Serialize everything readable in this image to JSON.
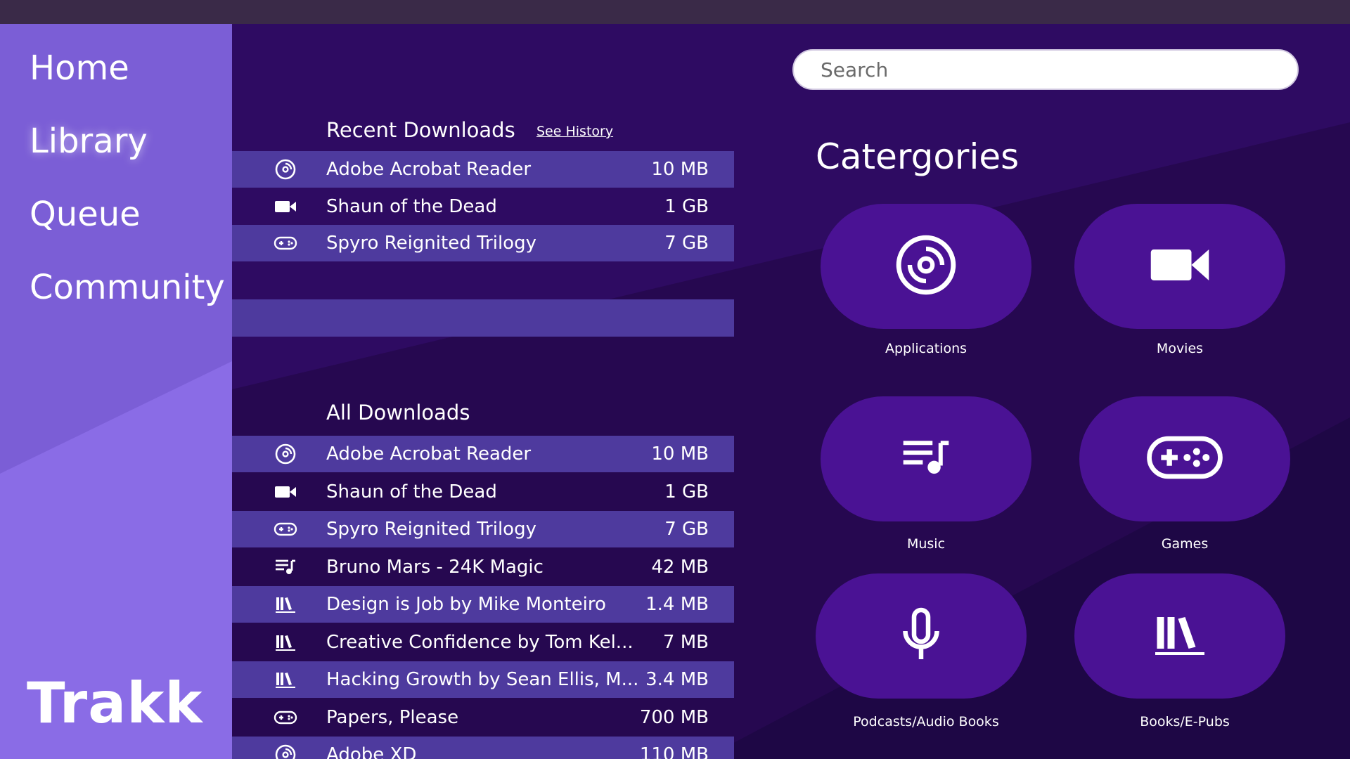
{
  "sidebar": {
    "items": [
      {
        "label": "Home",
        "active": false
      },
      {
        "label": "Library",
        "active": true
      },
      {
        "label": "Queue",
        "active": false
      },
      {
        "label": "Community",
        "active": false
      }
    ],
    "brand": "Trakk"
  },
  "recent": {
    "heading": "Recent Downloads",
    "see_history": "See History",
    "rows": [
      {
        "icon": "disc-icon",
        "name": "Adobe Acrobat Reader",
        "size": "10 MB"
      },
      {
        "icon": "video-camera-icon",
        "name": "Shaun of the Dead",
        "size": "1 GB"
      },
      {
        "icon": "gamepad-icon",
        "name": "Spyro Reignited Trilogy",
        "size": "7 GB"
      }
    ]
  },
  "all": {
    "heading": "All Downloads",
    "rows": [
      {
        "icon": "disc-icon",
        "name": "Adobe Acrobat Reader",
        "size": "10 MB"
      },
      {
        "icon": "video-camera-icon",
        "name": "Shaun of the Dead",
        "size": "1 GB"
      },
      {
        "icon": "gamepad-icon",
        "name": "Spyro Reignited Trilogy",
        "size": "7 GB"
      },
      {
        "icon": "music-list-icon",
        "name": "Bruno Mars - 24K Magic",
        "size": "42 MB"
      },
      {
        "icon": "books-icon",
        "name": "Design is Job by Mike Monteiro",
        "size": "1.4 MB"
      },
      {
        "icon": "books-icon",
        "name": "Creative Confidence by Tom Kel...",
        "size": "7 MB"
      },
      {
        "icon": "books-icon",
        "name": "Hacking Growth by Sean Ellis, M...",
        "size": "3.4 MB"
      },
      {
        "icon": "gamepad-icon",
        "name": "Papers, Please",
        "size": "700 MB"
      },
      {
        "icon": "disc-icon",
        "name": "Adobe XD",
        "size": "110 MB"
      }
    ]
  },
  "search": {
    "placeholder": "Search",
    "value": ""
  },
  "categories": {
    "title": "Catergories",
    "items": [
      {
        "icon": "disc-icon",
        "label": "Applications"
      },
      {
        "icon": "video-camera-icon",
        "label": "Movies"
      },
      {
        "icon": "music-list-icon",
        "label": "Music"
      },
      {
        "icon": "gamepad-icon",
        "label": "Games"
      },
      {
        "icon": "microphone-icon",
        "label": "Podcasts/Audio Books"
      },
      {
        "icon": "books-icon",
        "label": "Books/E-Pubs"
      }
    ]
  },
  "colors": {
    "sidebar": "#7b5ed6",
    "main_bg": "#2e0b62",
    "row_alt": "#4e3a9e",
    "category_pill": "#4a1294"
  }
}
